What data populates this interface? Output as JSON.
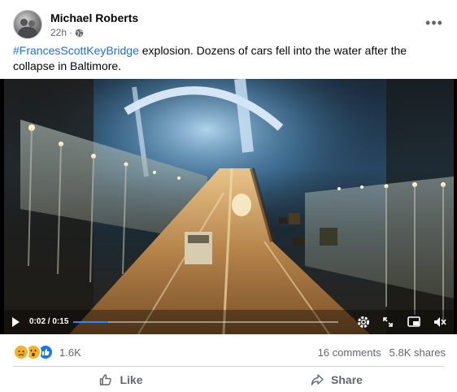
{
  "post": {
    "author": "Michael Roberts",
    "time": "22h",
    "more_icon": "more-horizontal-icon",
    "privacy_icon": "globe-icon",
    "caption_hashtag": "#FrancesScottKeyBridge",
    "caption_text": " explosion. Dozens of cars fell into the water after the collapse in Baltimore."
  },
  "video": {
    "current_time": "0:02",
    "separator": " / ",
    "duration": "0:15",
    "progress_fraction": 0.133,
    "accent_color": "#2d88ff"
  },
  "stats": {
    "reaction_count": "1.6K",
    "comments": "16 comments",
    "shares": "5.8K shares",
    "reactions": [
      "sad",
      "wow",
      "like"
    ]
  },
  "actions": {
    "like_label": "Like",
    "share_label": "Share"
  },
  "colors": {
    "link": "#216fdb",
    "secondary_text": "#65676b",
    "like_blue": "#1877f2"
  }
}
